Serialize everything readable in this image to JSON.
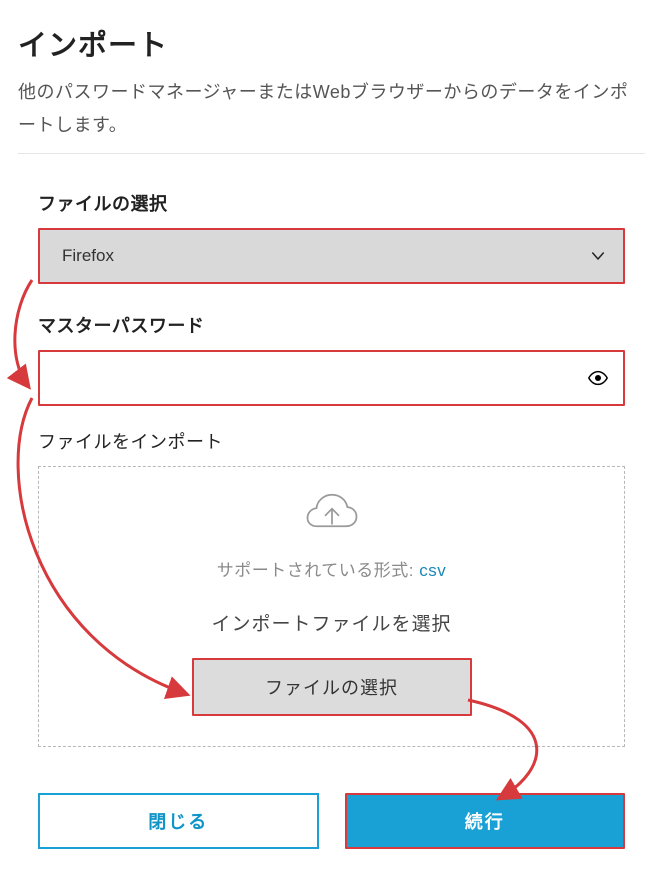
{
  "title": "インポート",
  "subtitle": "他のパスワードマネージャーまたはWebブラウザーからのデータをインポートします。",
  "file_select": {
    "label": "ファイルの選択",
    "value": "Firefox"
  },
  "master_password": {
    "label": "マスターパスワード",
    "value": ""
  },
  "import_file": {
    "label": "ファイルをインポート",
    "supported_prefix": "サポートされている形式: ",
    "supported_value": "csv",
    "select_file_text": "インポートファイルを選択",
    "file_button": "ファイルの選択"
  },
  "footer": {
    "close": "閉じる",
    "continue": "続行"
  }
}
